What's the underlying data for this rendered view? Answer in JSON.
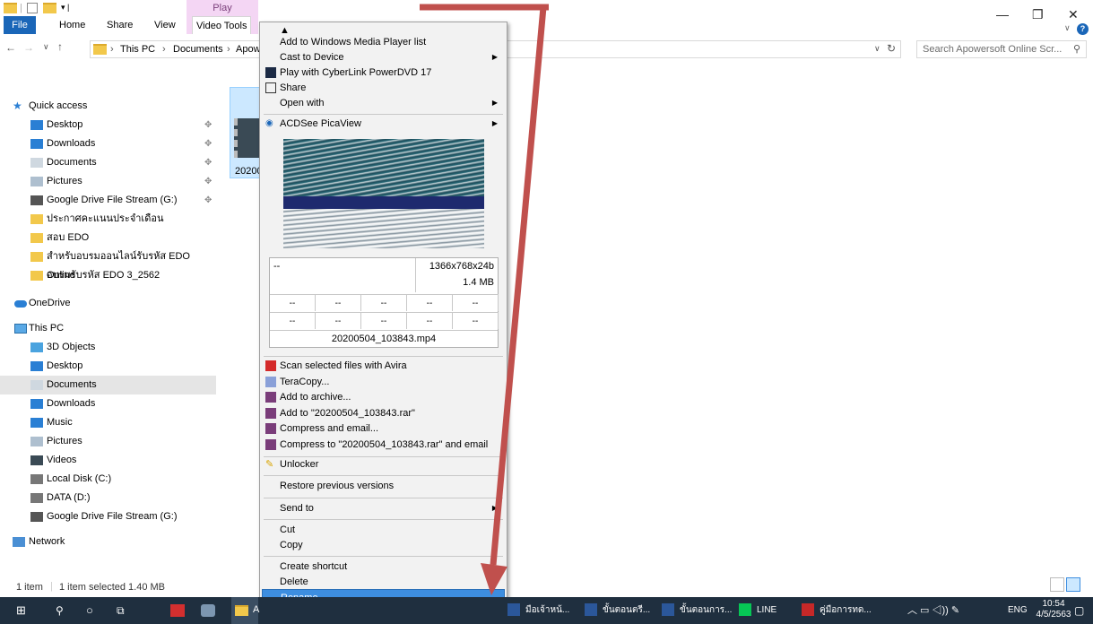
{
  "window": {
    "ribbon_context_tab": "Play",
    "tabs": [
      "File",
      "Home",
      "Share",
      "View",
      "Video Tools"
    ],
    "breadcrumb": [
      "This PC",
      "Documents",
      "Apow"
    ],
    "search_placeholder": "Search Apowersoft Online Scr...",
    "controls": {
      "minimize": "—",
      "maximize": "❐",
      "close": "✕",
      "help": "?"
    }
  },
  "nav": {
    "quick_access": "Quick access",
    "quick_items": [
      {
        "label": "Desktop",
        "icon": "desktop-icon",
        "pinned": true
      },
      {
        "label": "Downloads",
        "icon": "downloads-icon",
        "pinned": true
      },
      {
        "label": "Documents",
        "icon": "documents-icon",
        "pinned": true
      },
      {
        "label": "Pictures",
        "icon": "pictures-icon",
        "pinned": true
      },
      {
        "label": "Google Drive File Stream (G:)",
        "icon": "drive-icon",
        "pinned": true
      },
      {
        "label": "ประกาศคะแนนประจำเดือน",
        "icon": "folder-icon",
        "pinned": false
      },
      {
        "label": "สอบ EDO",
        "icon": "folder-icon",
        "pinned": false
      },
      {
        "label": "สำหรับอบรมออนไลน์รับรหัส EDO Online",
        "icon": "folder-icon",
        "pinned": false
      },
      {
        "label": "อบรมรับรหัส EDO 3_2562",
        "icon": "folder-icon",
        "pinned": false
      }
    ],
    "onedrive": "OneDrive",
    "this_pc": "This PC",
    "pc_items": [
      {
        "label": "3D Objects",
        "icon": "3d-objects-icon"
      },
      {
        "label": "Desktop",
        "icon": "desktop-icon"
      },
      {
        "label": "Documents",
        "icon": "documents-icon",
        "selected": true
      },
      {
        "label": "Downloads",
        "icon": "downloads-icon"
      },
      {
        "label": "Music",
        "icon": "music-icon"
      },
      {
        "label": "Pictures",
        "icon": "pictures-icon"
      },
      {
        "label": "Videos",
        "icon": "videos-icon"
      },
      {
        "label": "Local Disk (C:)",
        "icon": "disk-icon"
      },
      {
        "label": "DATA (D:)",
        "icon": "disk-icon"
      },
      {
        "label": "Google Drive File Stream (G:)",
        "icon": "drive-icon"
      }
    ],
    "network": "Network"
  },
  "file": {
    "label": "20200"
  },
  "status": {
    "count": "1 item",
    "selected": "1 item selected  1.40 MB"
  },
  "context_menu": {
    "top_arrow": "▲",
    "items1": [
      {
        "label": "Add to Windows Media Player list",
        "submenu": false
      },
      {
        "label": "Cast to Device",
        "submenu": true
      },
      {
        "label": "Play with CyberLink PowerDVD 17",
        "submenu": false,
        "icon": "powerdvd-icon"
      },
      {
        "label": "Share",
        "submenu": false,
        "icon": "share-icon"
      },
      {
        "label": "Open with",
        "submenu": true
      }
    ],
    "acdsee": "ACDSee PicaView",
    "info": {
      "left_top": "--",
      "resolution": "1366x768x24b",
      "size": "1.4 MB",
      "dashes": "--",
      "filename": "20200504_103843.mp4"
    },
    "items2": [
      {
        "label": "Scan selected files with Avira",
        "icon": "avira-icon"
      },
      {
        "label": "TeraCopy...",
        "icon": "teracopy-icon"
      },
      {
        "label": "Add to archive...",
        "icon": "winrar-icon"
      },
      {
        "label": "Add to \"20200504_103843.rar\"",
        "icon": "winrar-icon"
      },
      {
        "label": "Compress and email...",
        "icon": "winrar-icon"
      },
      {
        "label": "Compress to \"20200504_103843.rar\" and email",
        "icon": "winrar-icon"
      }
    ],
    "unlocker": "Unlocker",
    "restore": "Restore previous versions",
    "send_to": "Send to",
    "cut": "Cut",
    "copy": "Copy",
    "create_shortcut": "Create shortcut",
    "delete": "Delete",
    "rename": "Rename",
    "bottom_arrow": "▼"
  },
  "taskbar": {
    "apps": [
      {
        "label": "มือเจ้าหน้...",
        "icon": "word-icon"
      },
      {
        "label": "ขั้นตอนตรี...",
        "icon": "word-icon"
      },
      {
        "label": "ขั้นตอนการ...",
        "icon": "word-icon"
      },
      {
        "label": "LINE",
        "icon": "line-icon"
      },
      {
        "label": "คู่มือการทด...",
        "icon": "pdf-icon"
      }
    ],
    "lang": "ENG",
    "time": "10:54",
    "date": "4/5/2563",
    "explorer_partial": "A"
  },
  "colors": {
    "accent": "#1a66b8",
    "arrow": "#c0504d",
    "highlight": "#3d8ee0",
    "taskbar": "#1f2f3f"
  }
}
